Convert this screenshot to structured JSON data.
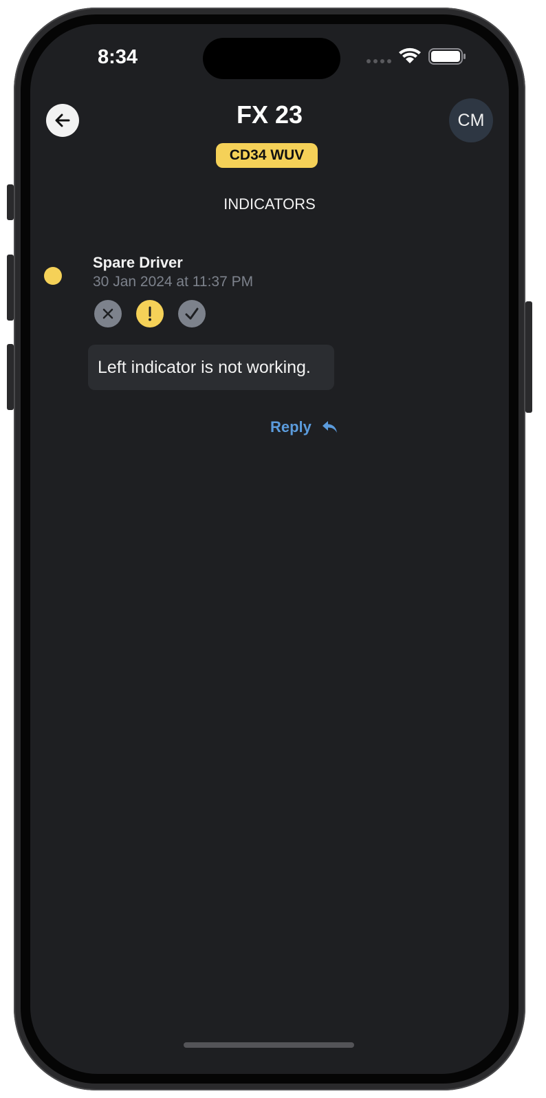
{
  "status_bar": {
    "time": "8:34"
  },
  "header": {
    "title": "FX 23",
    "plate": "CD34 WUV",
    "avatar_initials": "CM"
  },
  "section": {
    "title": "INDICATORS"
  },
  "comment": {
    "author": "Spare Driver",
    "timestamp": "30 Jan 2024 at 11:37 PM",
    "status_icons": [
      "close-icon",
      "exclamation-icon",
      "check-icon"
    ],
    "selected_status": "exclamation-icon",
    "message": "Left indicator is not working.",
    "reply_label": "Reply"
  },
  "colors": {
    "background": "#1e1f22",
    "accent_yellow": "#f5d158",
    "link_blue": "#5b9bdc",
    "muted_gray": "#7d828c",
    "avatar_bg": "#2e3743"
  }
}
